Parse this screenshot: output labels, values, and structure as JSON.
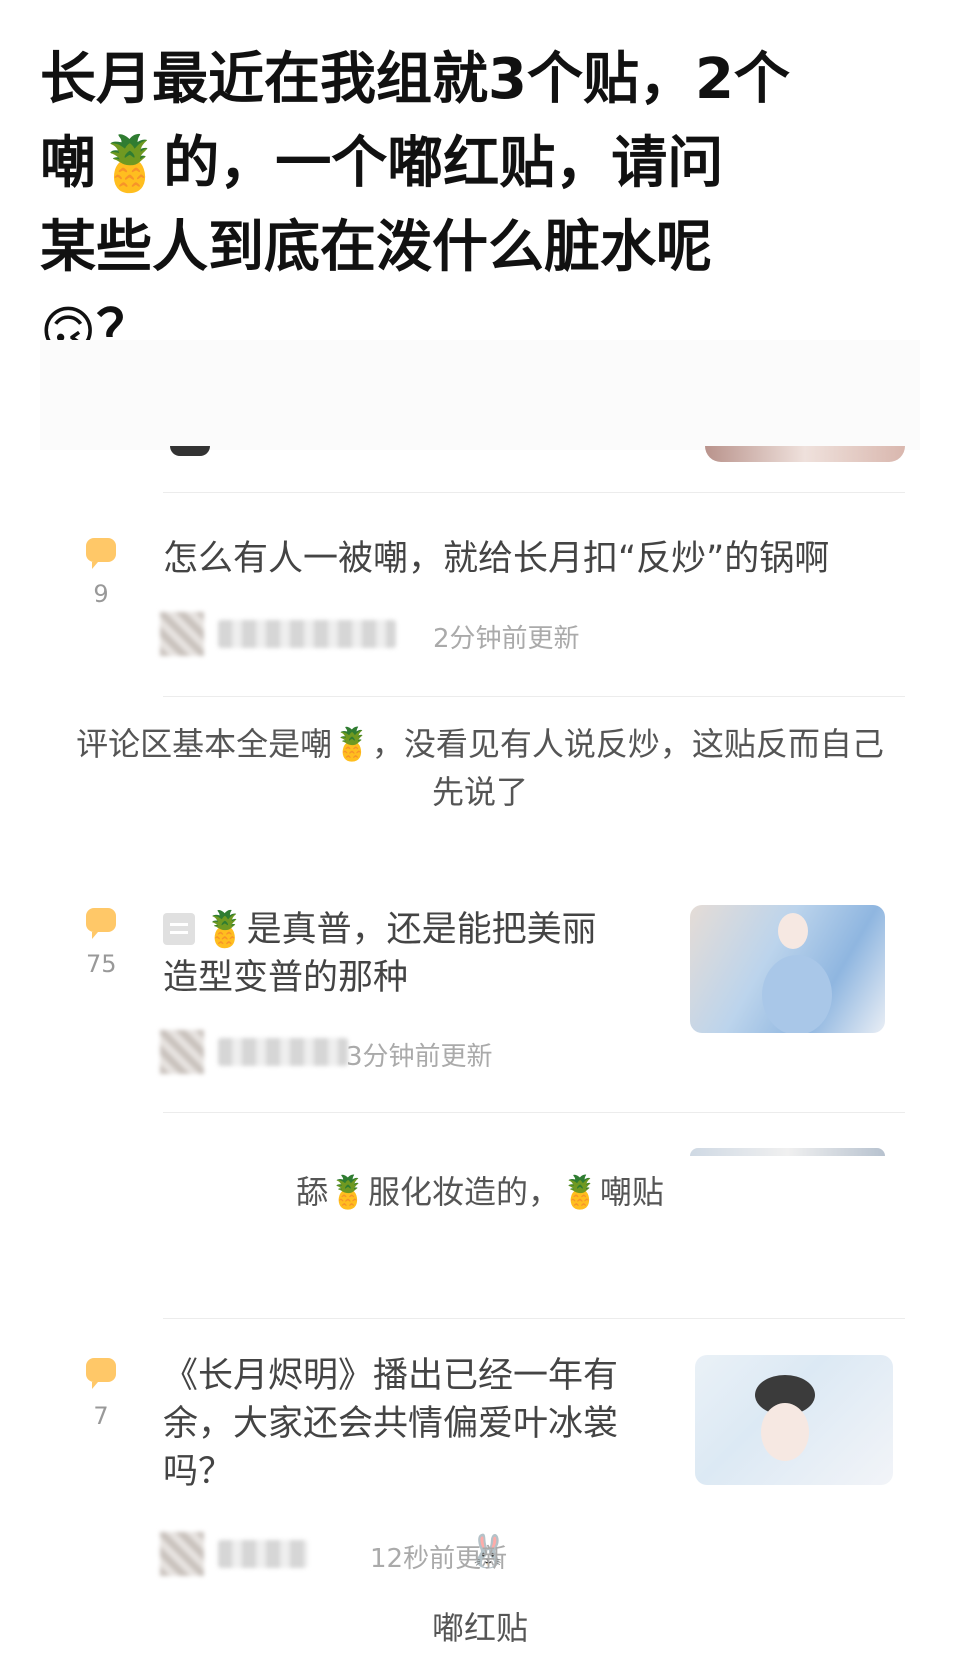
{
  "headline": {
    "line1": "长月最近在我组就3个贴，2个",
    "line2_a": "嘲",
    "line2_emoji": "🍍",
    "line2_b": "的，一个嘟红贴，请问",
    "line3": "某些人到底在泼什么脏水呢",
    "line4_emoji": "🙃",
    "line4_text": "？"
  },
  "posts": [
    {
      "title": "怎么有人一被嘲，就给长月扣“反炒”的锅啊",
      "count": "9",
      "time": "2分钟前更新",
      "caption_a": "评论区基本全是嘲",
      "caption_emoji": "🍍",
      "caption_b": "，没看见有人说反炒，这贴反而自己",
      "caption_c": "先说了"
    },
    {
      "title_emoji": "🍍",
      "title_line1": "是真普，还是能把美丽",
      "title_line2": "造型变普的那种",
      "count": "75",
      "time": "3分钟前更新",
      "caption_a": "舔",
      "caption_emoji1": "🍍",
      "caption_b": "服化妆造的，",
      "caption_emoji2": "🍍",
      "caption_c": "嘲贴"
    },
    {
      "title_line1": "《长月烬明》播出已经一年有",
      "title_line2": "余，大家还会共情偏爱叶冰裳",
      "title_line3": "吗？",
      "count": "7",
      "mascot": "🐰",
      "time": "12秒前更新",
      "caption": "嘟红贴"
    }
  ],
  "icons": {
    "comment": "comment-bubble-icon",
    "post_type": "image-post-icon"
  },
  "colors": {
    "accent": "#ffc868",
    "headline": "#111111",
    "meta": "#aaaaaa"
  }
}
